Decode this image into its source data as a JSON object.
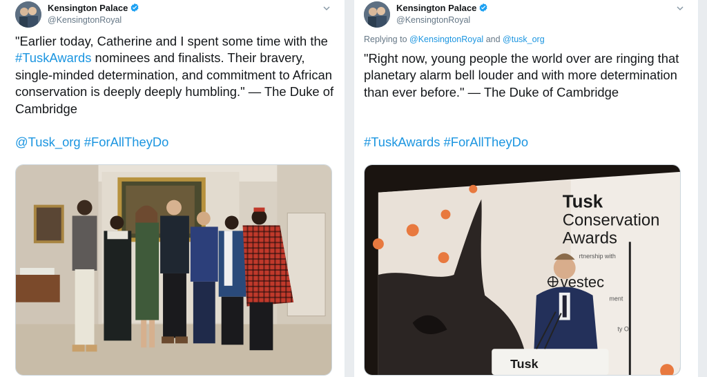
{
  "tweets": [
    {
      "author": {
        "display_name": "Kensington Palace",
        "handle": "@KensingtonRoyal",
        "verified": true
      },
      "text_before": "\"Earlier today, Catherine and I spent some time with the ",
      "hashtag_inline": "#TuskAwards",
      "text_after": " nominees and finalists. Their bravery, single-minded determination, and commitment to African conservation is deeply deeply humbling.\" — The Duke of Cambridge",
      "tags_line": "@Tusk_org #ForAllTheyDo",
      "media": {
        "icon": "group-photo-image"
      }
    },
    {
      "author": {
        "display_name": "Kensington Palace",
        "handle": "@KensingtonRoyal",
        "verified": true
      },
      "reply": {
        "prefix": "Replying to ",
        "to1": "@KensingtonRoyal",
        "joiner": " and ",
        "to2": "@tusk_org"
      },
      "text": "\"Right now, young people the world over are ringing that planetary alarm bell louder and with more determination than ever before.\" — The Duke of Cambridge",
      "tags_line": "#TuskAwards #ForAllTheyDo",
      "media": {
        "banner_line1": "Tusk",
        "banner_line2": "Conservation",
        "banner_line3": "Awards",
        "partnership": "rtnership with",
        "sponsor": "vestec",
        "sponsor_sub": "ment",
        "sponsor_sub2": "ty O",
        "podium_logo": "Tusk"
      }
    }
  ],
  "colors": {
    "link": "#1b95e0",
    "verified": "#1da1f2",
    "text": "#14171a",
    "muted": "#657786"
  }
}
